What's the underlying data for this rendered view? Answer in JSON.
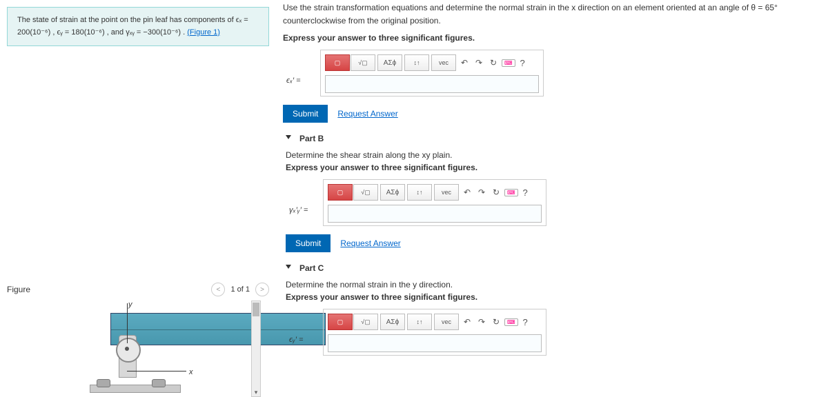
{
  "problem": {
    "text_before_ex": "The state of strain at the point on the pin leaf has components of ",
    "ex_label": "ϵₓ = 200(10⁻⁶)",
    "comma1": " , ",
    "ey_label": "ϵᵧ = 180(10⁻⁶)",
    "comma2": " , and ",
    "gxy_label": "γₓᵧ = −300(10⁻⁶)",
    "period": " . ",
    "figure_link": "(Figure 1)"
  },
  "intro": {
    "line": "Use the strain transformation equations and determine the normal strain in the x direction on an element oriented at an angle of θ = 65° counterclockwise from the original position.",
    "sigfig": "Express your answer to three significant figures."
  },
  "figure": {
    "title": "Figure",
    "nav_page": "1 of 1",
    "axis_y": "y",
    "axis_x": "x"
  },
  "toolbar": {
    "tmpl": "▢",
    "frac": "√▢",
    "greek": "ΑΣϕ",
    "arrows": "↕↑",
    "vec": "vec",
    "undo": "↶",
    "redo": "↷",
    "reset": "↻",
    "keyb": "⌨",
    "help": "?"
  },
  "partA": {
    "eq": "ϵₓ′  =",
    "submit": "Submit",
    "request": "Request Answer"
  },
  "partB": {
    "header": "Part B",
    "q": "Determine the shear strain along the xy plain.",
    "sig": "Express your answer to three significant figures.",
    "eq": "γₓ′ᵧ′  =",
    "submit": "Submit",
    "request": "Request Answer"
  },
  "partC": {
    "header": "Part C",
    "q": "Determine the normal strain in the y direction.",
    "sig": "Express your answer to three significant figures.",
    "eq": "ϵᵧ′  ="
  }
}
